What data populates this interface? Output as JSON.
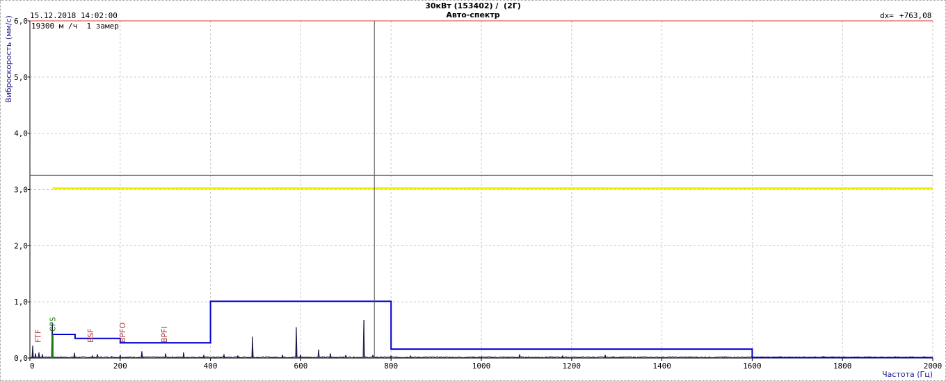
{
  "header": {
    "title": "30кВт (153402) /  (2Г)",
    "subtitle": "Авто-спектр",
    "datetime": "15.12.2018 14:02:00",
    "info": "19300 м /ч  1 замер",
    "dx_label": "dx=",
    "dx_value": "+763,08"
  },
  "colors": {
    "grid": "#c8c8c8",
    "limit_red": "#e03030",
    "spectrum": "#1a1a4a",
    "band": "#0000cc",
    "yellow": "#f0f000",
    "cursor": "#555555",
    "marker_red": "#b03030",
    "marker_green": "#1a7a1a",
    "axis_label": "#1a1a8a"
  },
  "chart_data": {
    "type": "line",
    "title": "30кВт (153402) /  (2Г)",
    "subtitle": "Авто-спектр",
    "xlabel": "Частота (Гц)",
    "ylabel": "Виброскорость (мм/с)",
    "xlim": [
      0,
      2000
    ],
    "ylim": [
      0,
      6.0
    ],
    "xticks": [
      0,
      200,
      400,
      600,
      800,
      1000,
      1200,
      1400,
      1600,
      1800,
      2000
    ],
    "xtick_labels": [
      "0",
      "200",
      "400",
      "600",
      "800",
      "1000",
      "1200",
      "1400",
      "1600",
      "1800",
      "2000"
    ],
    "yticks": [
      0,
      1,
      2,
      3,
      4,
      5,
      6
    ],
    "ytick_labels": [
      "0,0",
      "1,0",
      "2,0",
      "3,0",
      "4,0",
      "5,0",
      "6,0"
    ],
    "grid": true,
    "limit_line": 6.0,
    "cursor": {
      "x": 763.08,
      "y": 3.25
    },
    "yellow_level": {
      "from": 50,
      "to": 2000,
      "y": 3.02
    },
    "bands": [
      {
        "from": 50,
        "to": 100,
        "y": 0.42
      },
      {
        "from": 100,
        "to": 200,
        "y": 0.35
      },
      {
        "from": 200,
        "to": 400,
        "y": 0.27
      },
      {
        "from": 400,
        "to": 800,
        "y": 1.01
      },
      {
        "from": 800,
        "to": 1600,
        "y": 0.16
      },
      {
        "from": 1600,
        "to": 2000,
        "y": 0.01
      }
    ],
    "spectrum_peaks": [
      {
        "x": 6,
        "y": 0.22
      },
      {
        "x": 12,
        "y": 0.08
      },
      {
        "x": 20,
        "y": 0.1
      },
      {
        "x": 28,
        "y": 0.06
      },
      {
        "x": 50,
        "y": 0.62
      },
      {
        "x": 99,
        "y": 0.09
      },
      {
        "x": 138,
        "y": 0.04
      },
      {
        "x": 150,
        "y": 0.06
      },
      {
        "x": 180,
        "y": 0.03
      },
      {
        "x": 200,
        "y": 0.05
      },
      {
        "x": 248,
        "y": 0.12
      },
      {
        "x": 300,
        "y": 0.08
      },
      {
        "x": 340,
        "y": 0.1
      },
      {
        "x": 385,
        "y": 0.05
      },
      {
        "x": 430,
        "y": 0.06
      },
      {
        "x": 460,
        "y": 0.04
      },
      {
        "x": 493,
        "y": 0.38
      },
      {
        "x": 560,
        "y": 0.05
      },
      {
        "x": 590,
        "y": 0.55
      },
      {
        "x": 600,
        "y": 0.06
      },
      {
        "x": 640,
        "y": 0.15
      },
      {
        "x": 665,
        "y": 0.08
      },
      {
        "x": 700,
        "y": 0.05
      },
      {
        "x": 740,
        "y": 0.68
      },
      {
        "x": 760,
        "y": 0.05
      },
      {
        "x": 800,
        "y": 0.04
      },
      {
        "x": 843,
        "y": 0.04
      },
      {
        "x": 1000,
        "y": 0.03
      },
      {
        "x": 1085,
        "y": 0.06
      },
      {
        "x": 1180,
        "y": 0.04
      },
      {
        "x": 1275,
        "y": 0.05
      }
    ],
    "markers": [
      {
        "label": "FTF",
        "x": 18,
        "color": "red"
      },
      {
        "label": "CPS",
        "x": 50,
        "color": "green"
      },
      {
        "label": "BSF",
        "x": 134,
        "color": "red"
      },
      {
        "label": "BPFO",
        "x": 205,
        "color": "red"
      },
      {
        "label": "BPFI",
        "x": 297,
        "color": "red"
      }
    ]
  }
}
